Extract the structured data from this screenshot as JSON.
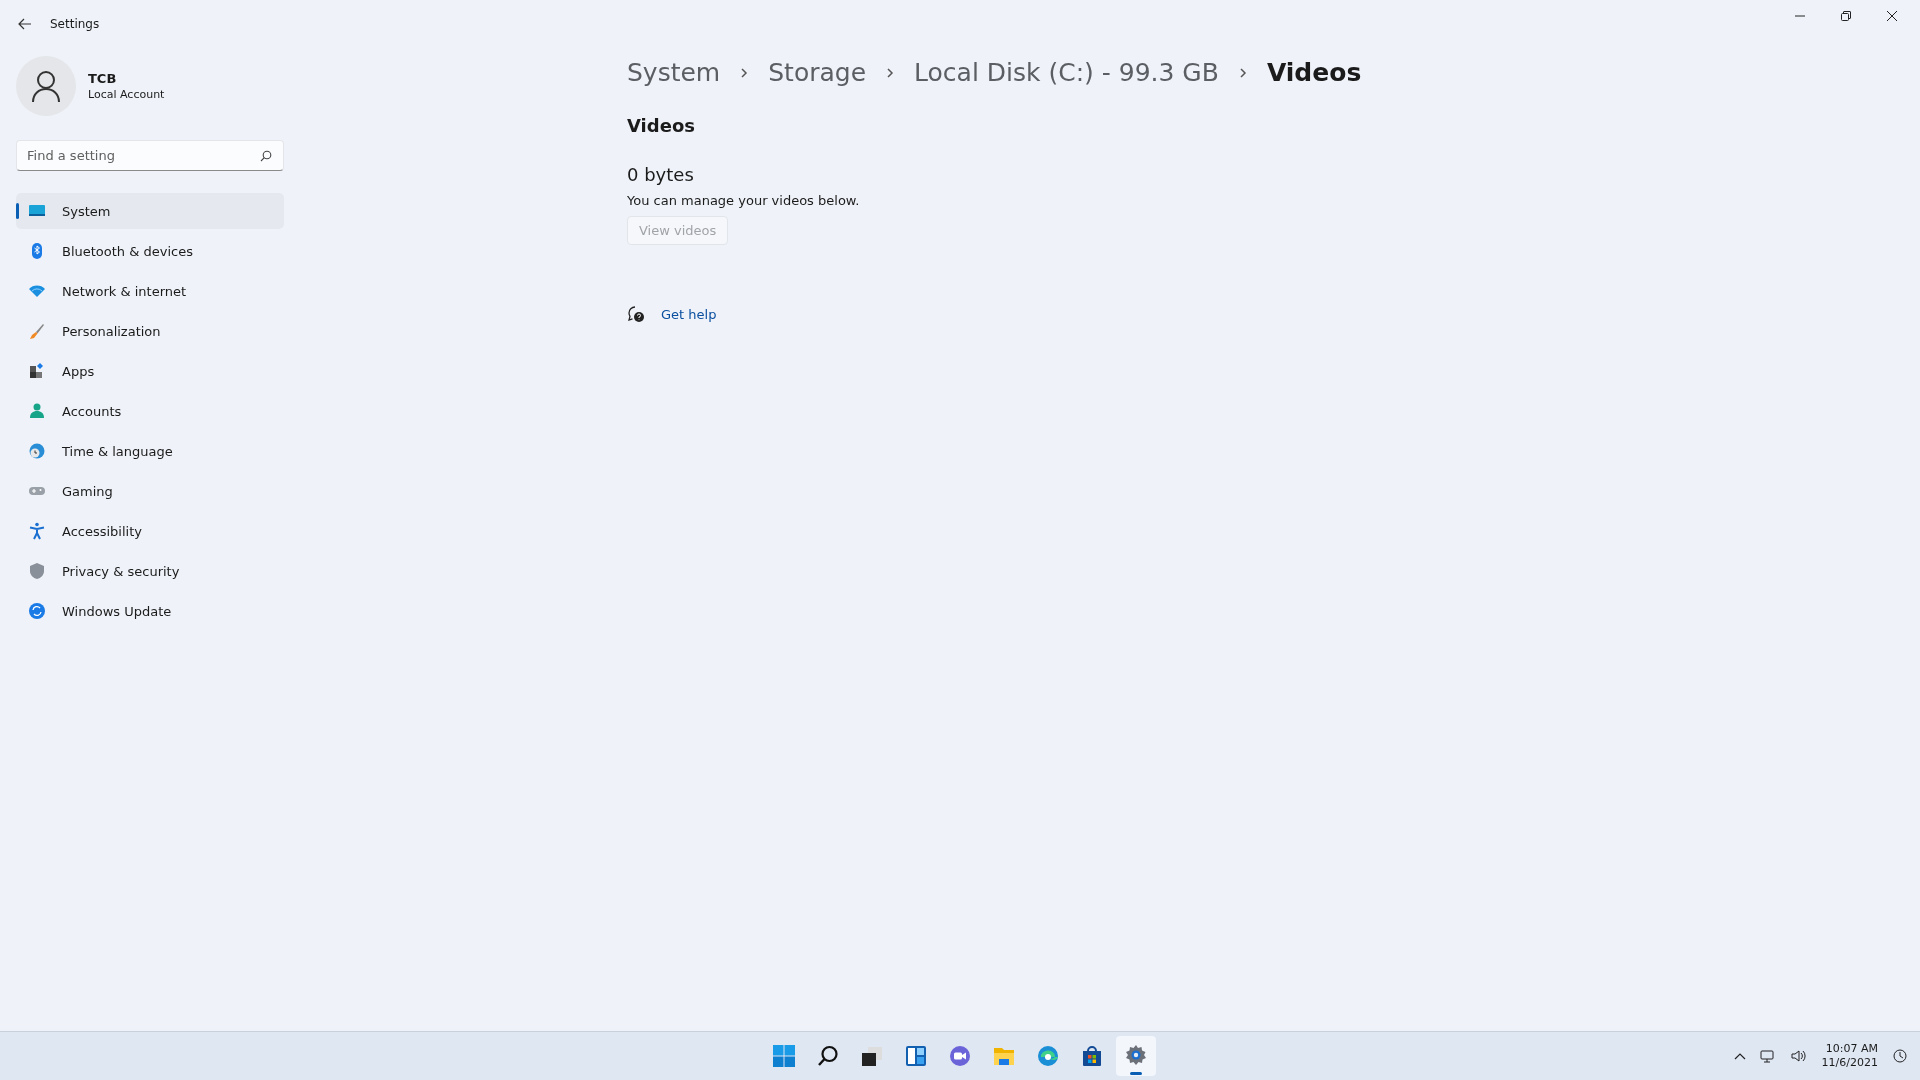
{
  "window": {
    "title": "Settings"
  },
  "user": {
    "name": "TCB",
    "account_type": "Local Account"
  },
  "search": {
    "placeholder": "Find a setting"
  },
  "sidebar": {
    "items": [
      {
        "label": "System",
        "kind": "system",
        "selected": true
      },
      {
        "label": "Bluetooth & devices",
        "kind": "bluetooth",
        "selected": false
      },
      {
        "label": "Network & internet",
        "kind": "network",
        "selected": false
      },
      {
        "label": "Personalization",
        "kind": "brush",
        "selected": false
      },
      {
        "label": "Apps",
        "kind": "apps",
        "selected": false
      },
      {
        "label": "Accounts",
        "kind": "accounts",
        "selected": false
      },
      {
        "label": "Time & language",
        "kind": "time",
        "selected": false
      },
      {
        "label": "Gaming",
        "kind": "gaming",
        "selected": false
      },
      {
        "label": "Accessibility",
        "kind": "accessibility",
        "selected": false
      },
      {
        "label": "Privacy & security",
        "kind": "privacy",
        "selected": false
      },
      {
        "label": "Windows Update",
        "kind": "update",
        "selected": false
      }
    ]
  },
  "breadcrumb": [
    "System",
    "Storage",
    "Local Disk (C:) - 99.3 GB",
    "Videos"
  ],
  "section": {
    "heading": "Videos",
    "size": "0 bytes",
    "description": "You can manage your videos below.",
    "button": {
      "label": "View videos",
      "disabled": true
    }
  },
  "help_link": "Get help",
  "taskbar": {
    "apps": [
      {
        "kind": "start",
        "selected": false
      },
      {
        "kind": "search",
        "selected": false
      },
      {
        "kind": "taskview",
        "selected": false
      },
      {
        "kind": "widgets",
        "selected": false
      },
      {
        "kind": "chat",
        "selected": false
      },
      {
        "kind": "explorer",
        "selected": false
      },
      {
        "kind": "browser",
        "selected": false
      },
      {
        "kind": "store",
        "selected": false
      },
      {
        "kind": "settings",
        "selected": true
      }
    ],
    "time": "10:07 AM",
    "date": "11/6/2021"
  }
}
